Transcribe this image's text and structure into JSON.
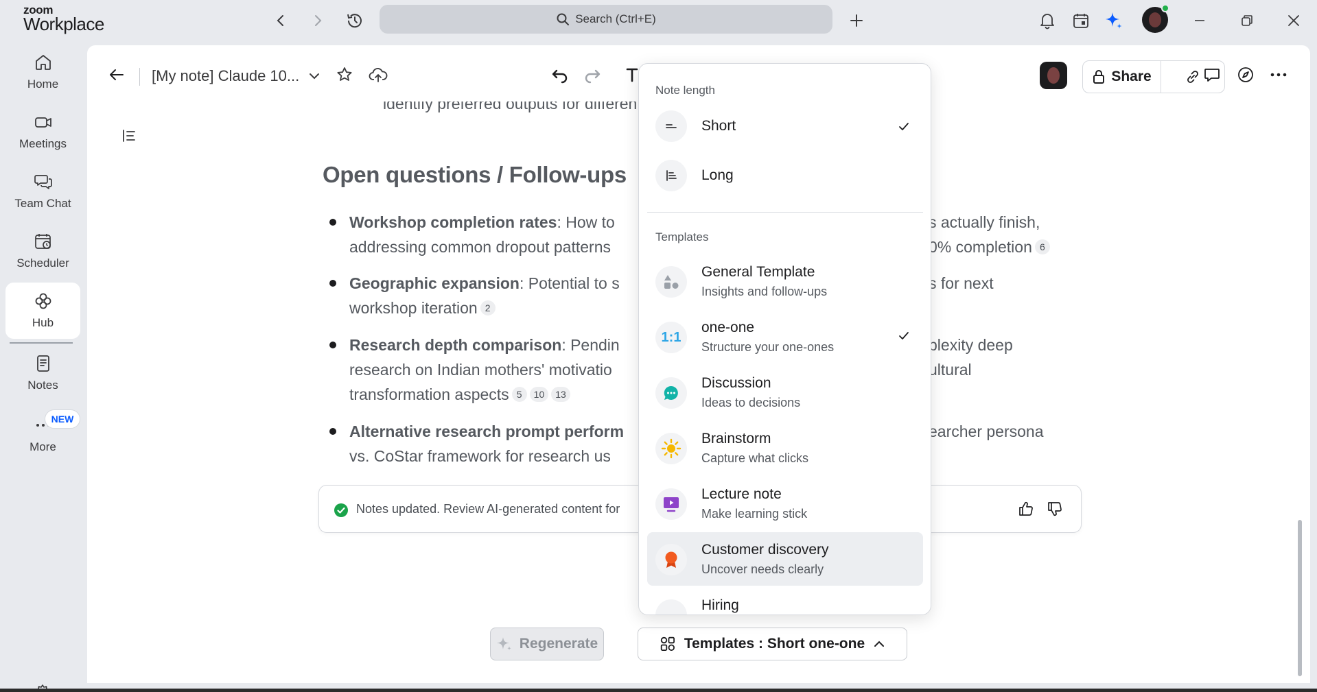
{
  "app": {
    "brand_top": "zoom",
    "brand_bottom": "Workplace"
  },
  "topbar": {
    "search_label": "Search (Ctrl+E)"
  },
  "rail": {
    "items": [
      {
        "label": "Home"
      },
      {
        "label": "Meetings"
      },
      {
        "label": "Team Chat"
      },
      {
        "label": "Scheduler"
      },
      {
        "label": "Hub"
      },
      {
        "label": "Notes"
      },
      {
        "label": "More"
      }
    ],
    "new_badge": "NEW"
  },
  "note": {
    "title": "[My note] Claude 10...",
    "share_label": "Share"
  },
  "doc": {
    "partial_line": "identify preferred outputs for differen",
    "heading": "Open questions / Follow-ups",
    "bullets": [
      {
        "bold": "Workshop completion rates",
        "rest1": ": How to ",
        "tail1": "s actually finish,",
        "line2": "addressing common dropout patterns",
        "tail2": "0% completion",
        "cites": [
          "6"
        ]
      },
      {
        "bold": "Geographic expansion",
        "rest1": ": Potential to s",
        "tail1": "s for next",
        "line2": "workshop iteration",
        "cites": [
          "2"
        ]
      },
      {
        "bold": "Research depth comparison",
        "rest1": ": Pendin",
        "tail1": "plexity deep",
        "line2": "research on Indian mothers' motivatio",
        "tail2": "ultural",
        "line3": "transformation aspects",
        "cites": [
          "5",
          "10",
          "13"
        ]
      },
      {
        "bold": "Alternative research prompt perform",
        "tail1": "earcher persona",
        "line2": "vs. CoStar framework for research us"
      }
    ],
    "notice": "Notes updated. Review AI-generated content for"
  },
  "popover": {
    "length_header": "Note length",
    "lengths": [
      {
        "label": "Short",
        "selected": true
      },
      {
        "label": "Long",
        "selected": false
      }
    ],
    "templates_header": "Templates",
    "templates": [
      {
        "title": "General Template",
        "subtitle": "Insights and follow-ups",
        "icon": "shapes-icon",
        "selected": false
      },
      {
        "title": "one-one",
        "subtitle": "Structure your one-ones",
        "icon": "one-to-one-icon",
        "icon_text": "1:1",
        "selected": true
      },
      {
        "title": "Discussion",
        "subtitle": "Ideas to decisions",
        "icon": "chat-bubble-icon",
        "selected": false
      },
      {
        "title": "Brainstorm",
        "subtitle": "Capture what clicks",
        "icon": "sun-icon",
        "selected": false
      },
      {
        "title": "Lecture note",
        "subtitle": "Make learning stick",
        "icon": "presentation-icon",
        "selected": false
      },
      {
        "title": "Customer discovery",
        "subtitle": "Uncover needs clearly",
        "icon": "award-icon",
        "selected": false,
        "hovered": true
      },
      {
        "title": "Hiring",
        "subtitle": "",
        "icon": "briefcase-icon",
        "selected": false
      }
    ]
  },
  "footer": {
    "regenerate_label": "Regenerate",
    "templates_label": "Templates : Short one-one"
  },
  "colors": {
    "accent_blue": "#0b5cff",
    "success_green": "#1aa34a",
    "teal": "#12b3a8",
    "sun": "#f5b700",
    "purple": "#8e44c9",
    "orange": "#f25a1f",
    "one_one_blue": "#2ea6e6"
  }
}
